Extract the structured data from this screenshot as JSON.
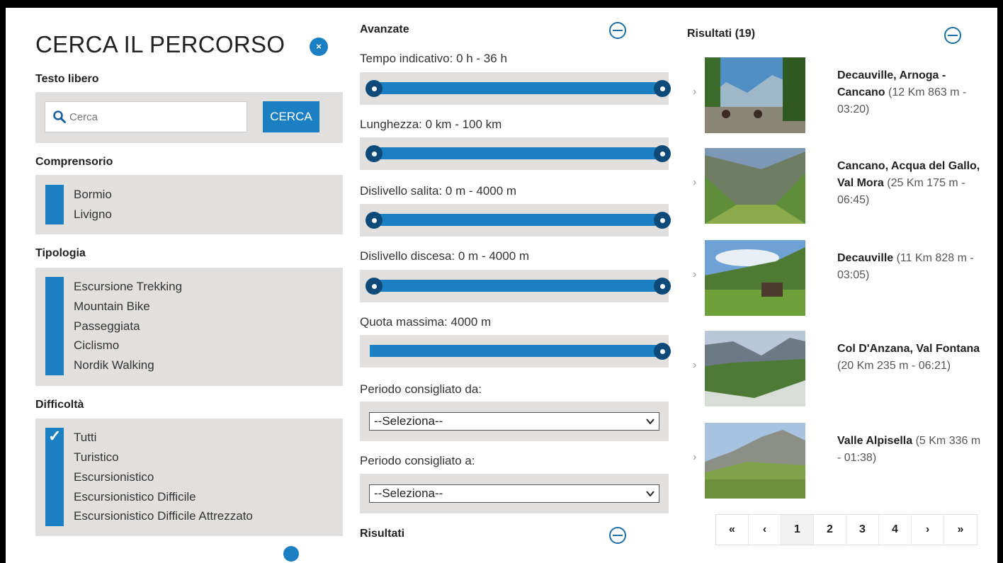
{
  "search_panel": {
    "title": "CERCA IL PERCORSO",
    "close_label": "×",
    "free_text_label": "Testo libero",
    "search_placeholder": "Cerca",
    "search_button": "CERCA",
    "area_label": "Comprensorio",
    "areas": [
      "Bormio",
      "Livigno"
    ],
    "type_label": "Tipologia",
    "types": [
      "Escursione Trekking",
      "Mountain Bike",
      "Passeggiata",
      "Ciclismo",
      "Nordik Walking"
    ],
    "difficulty_label": "Difficoltà",
    "difficulties": [
      "Tutti",
      "Turistico",
      "Escursionistico",
      "Escursionistico Difficile",
      "Escursionistico Difficile Attrezzato"
    ]
  },
  "advanced": {
    "heading": "Avanzate",
    "time_label": "Tempo indicativo:  0 h - 36 h",
    "length_label": "Lunghezza:  0 km - 100 km",
    "ascent_label": "Dislivello salita:  0 m - 4000 m",
    "descent_label": "Dislivello discesa:  0 m - 4000 m",
    "altitude_label": "Quota massima:  4000 m",
    "period_from_label": "Periodo consigliato da:",
    "period_from_value": "--Seleziona--",
    "period_to_label": "Periodo consigliato a:",
    "period_to_value": "--Seleziona--",
    "results_heading": "Risultati"
  },
  "results": {
    "title": "Risultati (19)",
    "items": [
      {
        "name": "Decauville, Arnoga - Cancano",
        "detail": " (12 Km 863 m - 03:20)"
      },
      {
        "name": "Cancano, Acqua del Gallo, Val Mora",
        "detail": " (25 Km 175 m - 06:45)"
      },
      {
        "name": "Decauville",
        "detail": " (11 Km 828 m - 03:05)"
      },
      {
        "name": "Col D'Anzana, Val Fontana",
        "detail": " (20 Km 235 m - 06:21)"
      },
      {
        "name": "Valle Alpisella",
        "detail": " (5 Km 336 m - 01:38)"
      }
    ]
  },
  "pagination": {
    "first": "«",
    "prev": "‹",
    "pages": [
      "1",
      "2",
      "3",
      "4"
    ],
    "next": "›",
    "last": "»"
  },
  "colors": {
    "accent": "#1b7fc4",
    "panel": "#e2e0de"
  }
}
